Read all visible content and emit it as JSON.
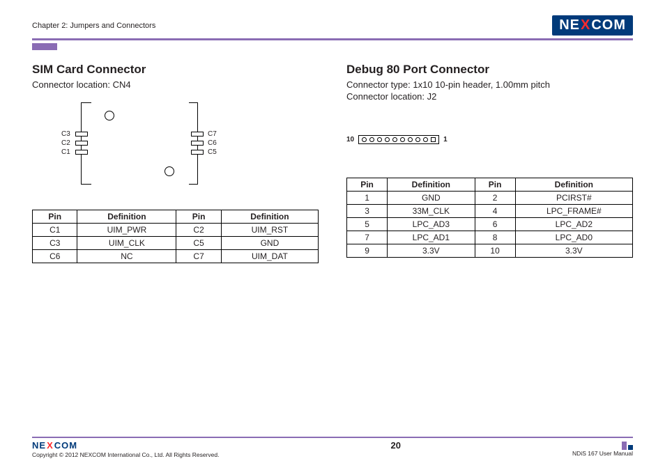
{
  "header": {
    "chapter": "Chapter 2: Jumpers and Connectors",
    "brand_pre": "NE",
    "brand_x": "X",
    "brand_post": "COM"
  },
  "sim": {
    "title": "SIM Card Connector",
    "location": "Connector location: CN4",
    "labels": {
      "c1": "C1",
      "c2": "C2",
      "c3": "C3",
      "c5": "C5",
      "c6": "C6",
      "c7": "C7"
    },
    "table": {
      "headers": [
        "Pin",
        "Definition",
        "Pin",
        "Definition"
      ],
      "rows": [
        [
          "C1",
          "UIM_PWR",
          "C2",
          "UIM_RST"
        ],
        [
          "C3",
          "UIM_CLK",
          "C5",
          "GND"
        ],
        [
          "C6",
          "NC",
          "C7",
          "UIM_DAT"
        ]
      ]
    }
  },
  "debug": {
    "title": "Debug 80 Port Connector",
    "type": "Connector type: 1x10 10-pin header, 1.00mm pitch",
    "location": "Connector location: J2",
    "pin_left": "10",
    "pin_right": "1",
    "table": {
      "headers": [
        "Pin",
        "Definition",
        "Pin",
        "Definition"
      ],
      "rows": [
        [
          "1",
          "GND",
          "2",
          "PCIRST#"
        ],
        [
          "3",
          "33M_CLK",
          "4",
          "LPC_FRAME#"
        ],
        [
          "5",
          "LPC_AD3",
          "6",
          "LPC_AD2"
        ],
        [
          "7",
          "LPC_AD1",
          "8",
          "LPC_AD0"
        ],
        [
          "9",
          "3.3V",
          "10",
          "3.3V"
        ]
      ]
    }
  },
  "footer": {
    "copyright": "Copyright © 2012 NEXCOM International Co., Ltd. All Rights Reserved.",
    "page": "20",
    "manual": "NDiS 167 User Manual"
  }
}
